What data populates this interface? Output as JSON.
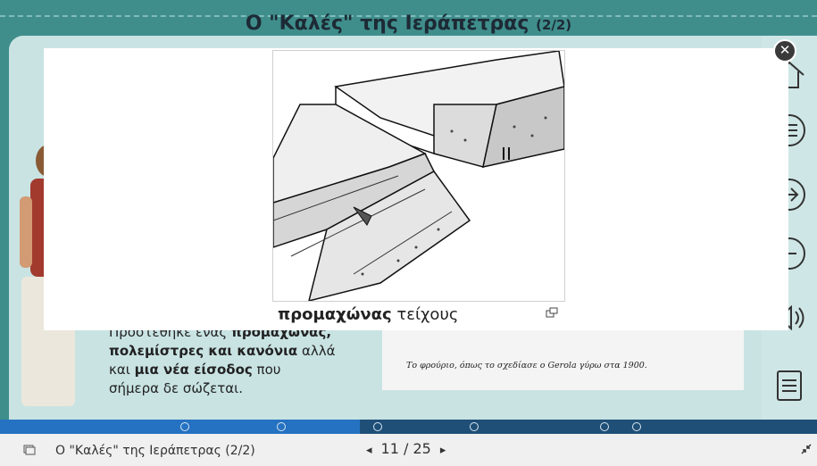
{
  "slide": {
    "title_main": "Ο \"Καλές\" της Ιεράπετρας",
    "title_sub": "(2/2)",
    "body": {
      "l1_pre": "Προστέθηκε ένας ",
      "l1_bold": "προμαχώνας,",
      "l2_bold": "πολεμίστρες και κανόνια",
      "l2_post": " αλλά",
      "l3_pre": "και ",
      "l3_bold": "μια νέα είσοδος",
      "l3_post": " που",
      "l4": "σήμερα δε σώζεται."
    },
    "card_caption": "Το φρούριο, όπως το σχεδίασε ο Gerola γύρω στα 1900."
  },
  "modal": {
    "caption_bold": "προμαχώνας",
    "caption_rest": " τείχους",
    "close_symbol": "✕"
  },
  "footer": {
    "breadcrumb": "Ο \"Καλές\" της Ιεράπετρας (2/2)",
    "current_page": "11",
    "separator": "/",
    "total_pages": "25",
    "prev_symbol": "◂",
    "next_symbol": "▸"
  },
  "progress": {
    "fraction": 0.44
  },
  "icons": [
    "home-icon",
    "menu-icon",
    "next-icon",
    "prev-icon",
    "audio-icon",
    "list-icon",
    "close-icon",
    "expand-icon",
    "minimize-icon",
    "slides-icon"
  ]
}
